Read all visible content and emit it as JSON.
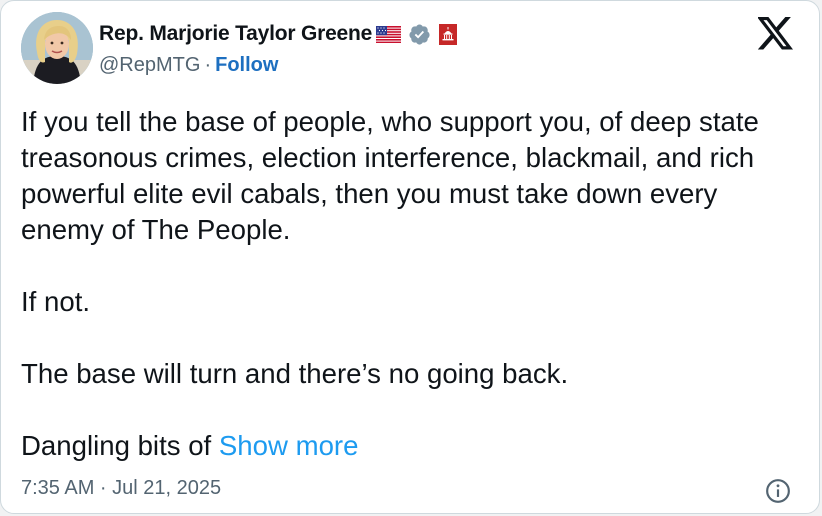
{
  "author": {
    "display_name": "Rep. Marjorie Taylor Greene",
    "handle": "@RepMTG",
    "separator": "·",
    "follow_label": "Follow",
    "badges": [
      "us-flag-icon",
      "verified-badge-icon",
      "capitol-icon"
    ]
  },
  "tweet": {
    "paragraphs": [
      "If you tell the base of people, who support you, of deep state treasonous crimes, election interference, blackmail, and rich powerful elite evil cabals, then you must take down every enemy of The People.",
      "If not.",
      "The base will turn and there’s no going back."
    ],
    "truncated_text": "Dangling bits of",
    "show_more_label": "Show more"
  },
  "footer": {
    "timestamp": "7:35 AM · Jul 21, 2025",
    "info_icon": "info-icon"
  },
  "logo": "x-logo-icon",
  "colors": {
    "text": "#0f1419",
    "secondary": "#536471",
    "link": "#1d9bf0",
    "verified_badge": "#829aab",
    "capitol_badge": "#c62828"
  }
}
